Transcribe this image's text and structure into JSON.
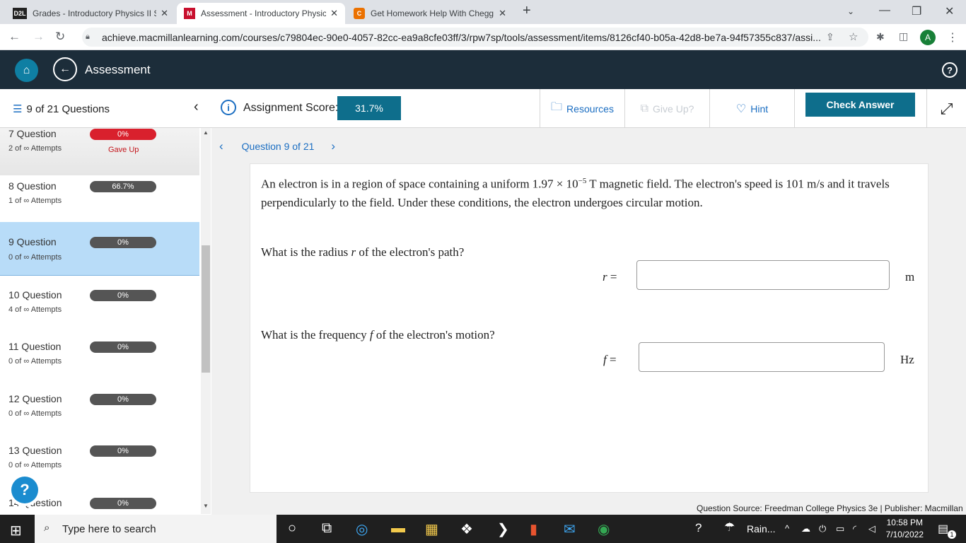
{
  "browser": {
    "tabs": [
      {
        "favicon": "D2L",
        "title": "Grades - Introductory Physics II S"
      },
      {
        "favicon": "M",
        "title": "Assessment - Introductory Physic"
      },
      {
        "favicon": "C",
        "title": "Get Homework Help With Chegg"
      }
    ],
    "new_tab": "+",
    "url": "achieve.macmillanlearning.com/courses/c79804ec-90e0-4057-82cc-ea9a8cfe03ff/3/rpw7sp/tools/assessment/items/8126cf40-b05a-42d8-be7a-94f57355c837/assi...",
    "profile_initial": "A"
  },
  "header": {
    "title": "Assessment",
    "help": "?"
  },
  "toolbar": {
    "question_count": "9 of 21 Questions",
    "score_label": "Assignment Score:",
    "score_value": "31.7%",
    "resources": "Resources",
    "give_up": "Give Up?",
    "hint": "Hint",
    "check_answer": "Check Answer"
  },
  "sidebar": {
    "items": [
      {
        "name": "7 Question",
        "attempts": "2 of ∞ Attempts",
        "badge": "0%",
        "status": "Gave Up"
      },
      {
        "name": "8 Question",
        "attempts": "1 of ∞ Attempts",
        "badge": "66.7%",
        "status": ""
      },
      {
        "name": "9 Question",
        "attempts": "0 of ∞ Attempts",
        "badge": "0%",
        "status": ""
      },
      {
        "name": "10 Question",
        "attempts": "4 of ∞ Attempts",
        "badge": "0%",
        "status": ""
      },
      {
        "name": "11 Question",
        "attempts": "0 of ∞ Attempts",
        "badge": "0%",
        "status": ""
      },
      {
        "name": "12 Question",
        "attempts": "0 of ∞ Attempts",
        "badge": "0%",
        "status": ""
      },
      {
        "name": "13 Question",
        "attempts": "0 of ∞ Attempts",
        "badge": "0%",
        "status": ""
      },
      {
        "name": "14 Question",
        "attempts": "",
        "badge": "0%",
        "status": ""
      }
    ],
    "help_fab": "?"
  },
  "question": {
    "nav_label": "Question 9 of 21",
    "text_part1": "An electron is in a region of space containing a uniform 1.97 × 10",
    "exponent": "−5",
    "text_part2": " T magnetic field. The electron's speed is 101 m/s and it travels perpendicularly to the field. Under these conditions, the electron undergoes circular motion.",
    "sub1_prompt_a": "What is the radius ",
    "sub1_var": "r",
    "sub1_prompt_b": " of the electron's path?",
    "sub1_label": "r",
    "sub1_eq": "=",
    "sub1_value": "",
    "sub1_unit": "m",
    "sub2_prompt_a": "What is the frequency ",
    "sub2_var": "f",
    "sub2_prompt_b": " of the electron's motion?",
    "sub2_label": "f",
    "sub2_eq": "=",
    "sub2_value": "",
    "sub2_unit": "Hz",
    "source": "Question Source: Freedman College Physics 3e   |   Publisher: Macmillan"
  },
  "taskbar": {
    "search_placeholder": "Type here to search",
    "weather": "Rain...",
    "time": "10:58 PM",
    "date": "7/10/2022",
    "notif_count": "1"
  }
}
